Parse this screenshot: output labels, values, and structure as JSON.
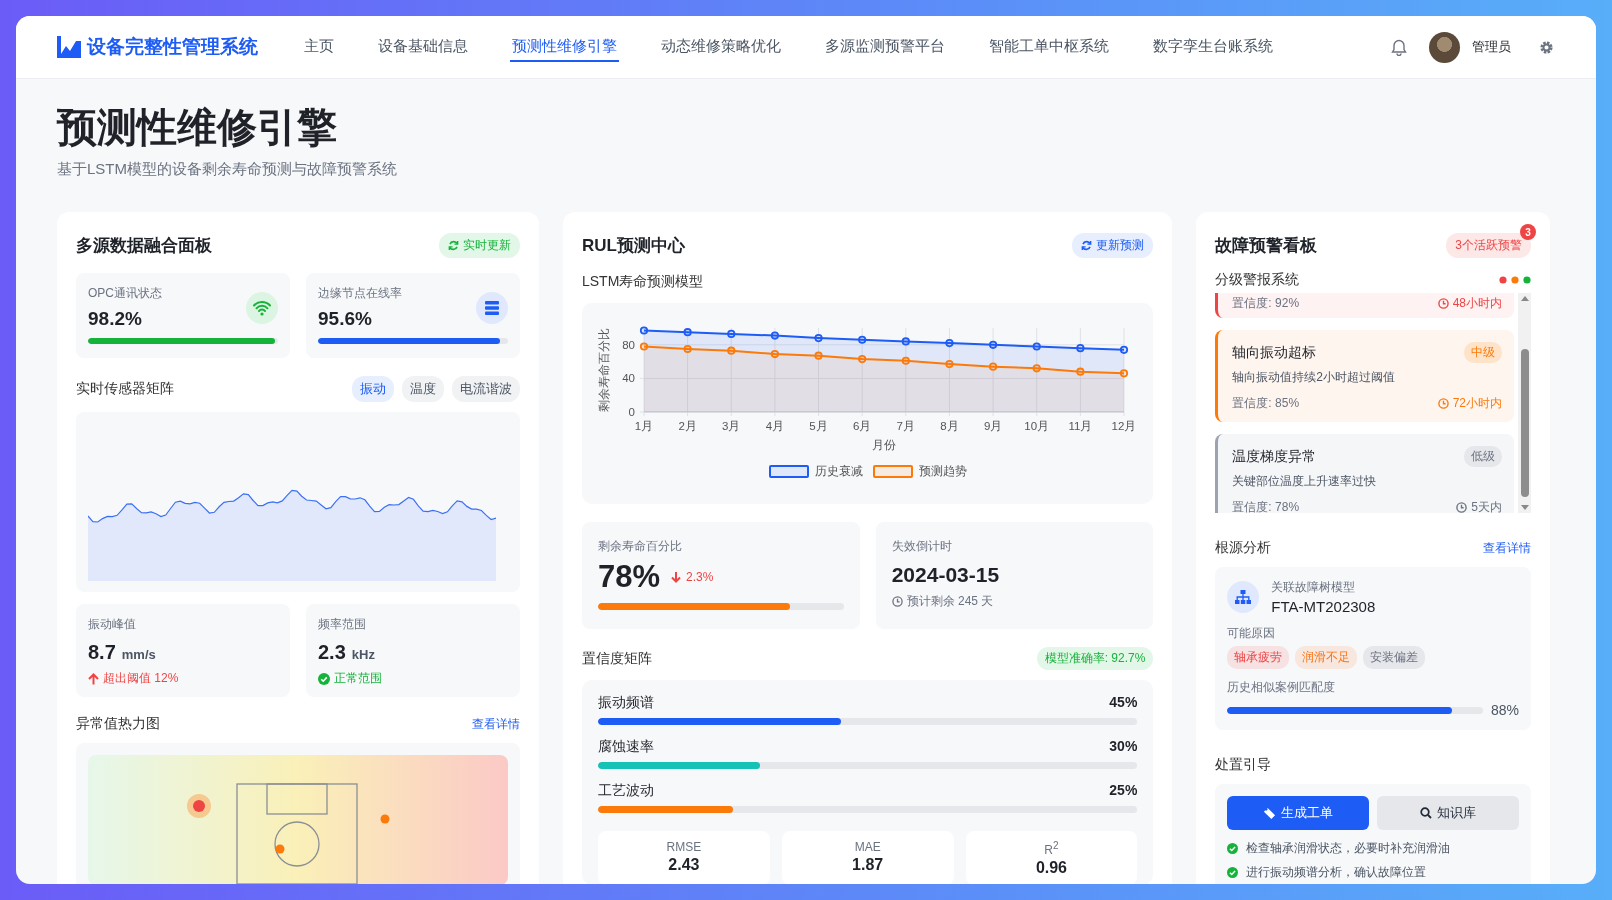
{
  "app": {
    "logo_text": "设备完整性管理系统",
    "nav": [
      {
        "label": "主页",
        "selected": false
      },
      {
        "label": "设备基础信息",
        "selected": false
      },
      {
        "label": "预测性维修引擎",
        "selected": true
      },
      {
        "label": "动态维修策略优化",
        "selected": false
      },
      {
        "label": "多源监测预警平台",
        "selected": false
      },
      {
        "label": "智能工单中枢系统",
        "selected": false
      },
      {
        "label": "数字孪生台账系统",
        "selected": false
      }
    ],
    "user": {
      "name": "管理员"
    }
  },
  "page": {
    "title": "预测性维修引擎",
    "subtitle": "基于LSTM模型的设备剩余寿命预测与故障预警系统"
  },
  "fusion_panel": {
    "title": "多源数据融合面板",
    "badge": "实时更新",
    "stats": [
      {
        "label": "OPC通讯状态",
        "value": "98.2%",
        "level": 0.982,
        "kind": "wifi"
      },
      {
        "label": "边缘节点在线率",
        "value": "95.6%",
        "level": 0.956,
        "kind": "server"
      }
    ],
    "sensor": {
      "title": "实时传感器矩阵",
      "tabs": [
        {
          "label": "振动",
          "selected": true
        },
        {
          "label": "温度",
          "selected": false
        },
        {
          "label": "电流谐波",
          "selected": false
        }
      ]
    },
    "metrics": [
      {
        "label": "振动峰值",
        "value": "8.7",
        "unit": "mm/s",
        "note": "超出阈值 12%",
        "kind": "warning"
      },
      {
        "label": "频率范围",
        "value": "2.3",
        "unit": "kHz",
        "note": "正常范围",
        "kind": "ok"
      }
    ],
    "heatmap": {
      "title": "异常值热力图",
      "link": "查看详情"
    }
  },
  "rul_center": {
    "title": "RUL预测中心",
    "button": "更新预测",
    "chart_title": "LSTM寿命预测模型",
    "chart_data": {
      "type": "area",
      "xlabel": "月份",
      "ylabel": "剩余寿命百分比",
      "x": [
        "1月",
        "2月",
        "3月",
        "4月",
        "5月",
        "6月",
        "7月",
        "8月",
        "9月",
        "10月",
        "11月",
        "12月"
      ],
      "ylim": [
        0,
        100
      ],
      "yticks": [
        0,
        40,
        80
      ],
      "grid": true,
      "legend": true,
      "series": [
        {
          "name": "历史衰减",
          "color": "#1d5cf5",
          "values": [
            97,
            95,
            93,
            91,
            88,
            86,
            84,
            82,
            80,
            78,
            76,
            74
          ]
        },
        {
          "name": "预测趋势",
          "color": "#fb7a0a",
          "values": [
            78,
            75,
            73,
            69,
            67,
            63,
            61,
            57,
            54,
            52,
            48,
            46
          ]
        }
      ]
    },
    "remaining": {
      "label": "剩余寿命百分比",
      "value": "78%",
      "change": "2.3%",
      "level": 0.78
    },
    "countdown": {
      "label": "失效倒计时",
      "date": "2024-03-15",
      "note": "预计剩余 245 天"
    },
    "confidence": {
      "title": "置信度矩阵",
      "badge": "模型准确率: 92.7%",
      "factors": [
        {
          "name": "振动频谱",
          "value": "45%",
          "level": 0.45,
          "color": "#1d5cf5"
        },
        {
          "name": "腐蚀速率",
          "value": "30%",
          "level": 0.3,
          "color": "#14c3b5"
        },
        {
          "name": "工艺波动",
          "value": "25%",
          "level": 0.25,
          "color": "#fb7a0a"
        }
      ],
      "scores": [
        {
          "label": "RMSE",
          "value": "2.43"
        },
        {
          "label": "MAE",
          "value": "1.87"
        },
        {
          "label": "R$^{2}$",
          "value": "0.96"
        }
      ]
    }
  },
  "alert_board": {
    "title": "故障预警看板",
    "badge": "3个活跃预警",
    "count": "3",
    "subtitle": "分级警报系统",
    "alerts": [
      {
        "kind": "high",
        "confidence": "置信度: 92%",
        "eta": "48小时内"
      },
      {
        "kind": "medium",
        "title": "轴向振动超标",
        "badge": "中级",
        "desc": "轴向振动值持续2小时超过阈值",
        "confidence": "置信度: 85%",
        "eta": "72小时内"
      },
      {
        "kind": "low",
        "title": "温度梯度异常",
        "badge": "低级",
        "desc": "关键部位温度上升速率过快",
        "confidence": "置信度: 78%",
        "eta": "5天内"
      }
    ],
    "root_cause": {
      "title": "根源分析",
      "link": "查看详情",
      "model_label": "关联故障树模型",
      "model_id": "FTA-MT202308",
      "causes_label": "可能原因",
      "causes": [
        {
          "label": "轴承疲劳",
          "color": "#ef4444"
        },
        {
          "label": "润滑不足",
          "color": "#f97316"
        },
        {
          "label": "安装偏差",
          "color": "#6b7280"
        }
      ],
      "match_label": "历史相似案例匹配度",
      "match_value": "88%",
      "level": 0.88
    },
    "guide": {
      "title": "处置引导",
      "buttons": [
        {
          "label": "生成工单",
          "kind": "primary"
        },
        {
          "label": "知识库",
          "kind": "secondary"
        }
      ],
      "steps": [
        "检查轴承润滑状态，必要时补充润滑油",
        "进行振动频谱分析，确认故障位置"
      ]
    }
  }
}
